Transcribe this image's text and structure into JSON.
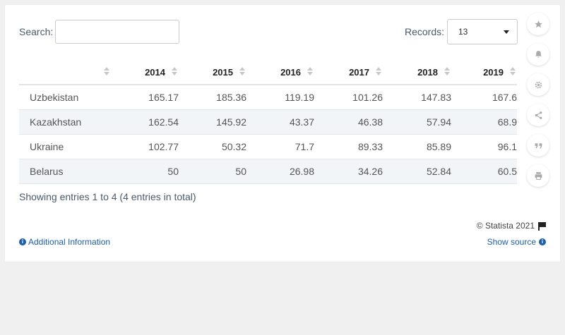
{
  "search": {
    "label": "Search:",
    "placeholder": "",
    "value": ""
  },
  "records": {
    "label": "Records:",
    "value": "13"
  },
  "table": {
    "headers": [
      "",
      "2014",
      "2015",
      "2016",
      "2017",
      "2018",
      "2019"
    ],
    "rows": [
      {
        "name": "Uzbekistan",
        "values": [
          "165.17",
          "185.36",
          "119.19",
          "101.26",
          "147.83",
          "167.6"
        ]
      },
      {
        "name": "Kazakhstan",
        "values": [
          "162.54",
          "145.92",
          "43.37",
          "46.38",
          "57.94",
          "68.9"
        ]
      },
      {
        "name": "Ukraine",
        "values": [
          "102.77",
          "50.32",
          "71.7",
          "89.33",
          "85.89",
          "96.1"
        ]
      },
      {
        "name": "Belarus",
        "values": [
          "50",
          "50",
          "26.98",
          "34.26",
          "52.84",
          "60.5"
        ]
      }
    ]
  },
  "footer": {
    "showing": "Showing entries 1 to 4 (4 entries in total)",
    "copyright": "© Statista 2021",
    "additional_info": "Additional Information",
    "show_source": "Show source"
  },
  "sidebar_icons": [
    "star-icon",
    "bell-icon",
    "gear-icon",
    "share-icon",
    "quote-icon",
    "print-icon"
  ],
  "colors": {
    "link": "#1c5fa8",
    "row_stripe": "#f2f5f8"
  }
}
